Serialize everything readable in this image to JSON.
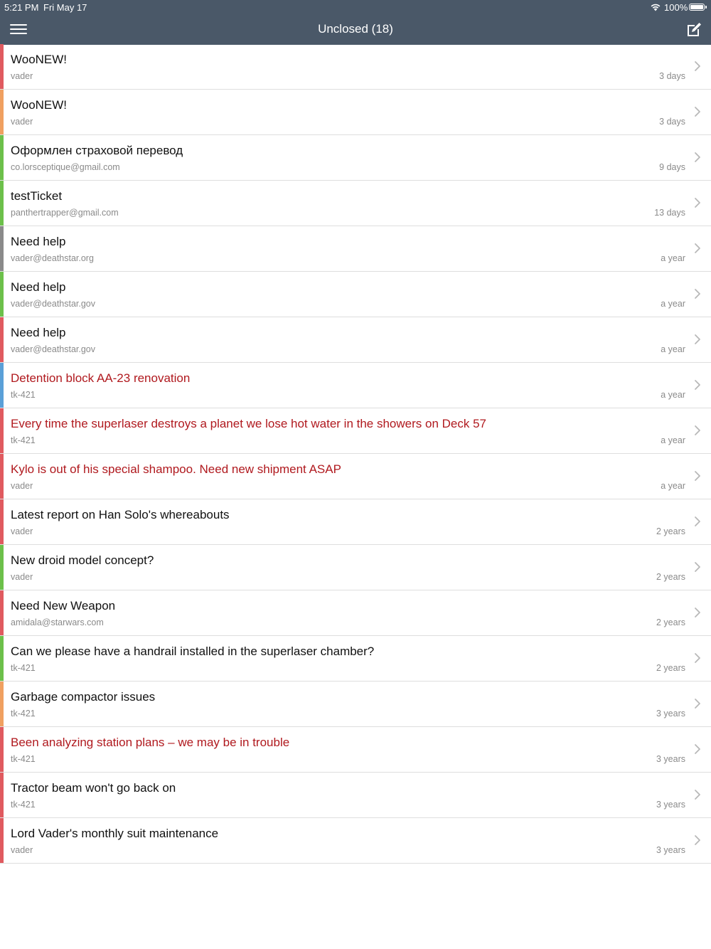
{
  "status_bar": {
    "time": "5:21 PM",
    "date": "Fri May 17",
    "battery": "100%"
  },
  "nav": {
    "title": "Unclosed (18)",
    "menu_icon": "hamburger-icon",
    "compose_icon": "compose-icon"
  },
  "colors": {
    "header": "#4a5868",
    "red": "#e05a5f",
    "orange": "#f0a060",
    "green": "#6cc04a",
    "gray": "#8a8a8a",
    "blue": "#5aa0d8",
    "urgent_text": "#b0191e"
  },
  "tickets": [
    {
      "subject": "WooNEW!",
      "sender": "vader",
      "age": "3 days",
      "bar": "#e05a5f",
      "urgent": false
    },
    {
      "subject": "WooNEW!",
      "sender": "vader",
      "age": "3 days",
      "bar": "#f0a060",
      "urgent": false
    },
    {
      "subject": "Оформлен страховой перевод",
      "sender": "co.lorsceptique@gmail.com",
      "age": "9 days",
      "bar": "#6cc04a",
      "urgent": false
    },
    {
      "subject": "testTicket",
      "sender": "panthertrapper@gmail.com",
      "age": "13 days",
      "bar": "#6cc04a",
      "urgent": false
    },
    {
      "subject": "Need help",
      "sender": "vader@deathstar.org",
      "age": "a year",
      "bar": "#8a8a8a",
      "urgent": false
    },
    {
      "subject": "Need help",
      "sender": "vader@deathstar.gov",
      "age": "a year",
      "bar": "#6cc04a",
      "urgent": false
    },
    {
      "subject": "Need help",
      "sender": "vader@deathstar.gov",
      "age": "a year",
      "bar": "#e05a5f",
      "urgent": false
    },
    {
      "subject": "Detention block AA-23 renovation",
      "sender": "tk-421",
      "age": "a year",
      "bar": "#5aa0d8",
      "urgent": true
    },
    {
      "subject": "Every time the superlaser destroys a planet we lose hot water in the showers on Deck 57",
      "sender": "tk-421",
      "age": "a year",
      "bar": "#e05a5f",
      "urgent": true
    },
    {
      "subject": "Kylo is out of his special shampoo. Need new shipment ASAP",
      "sender": "vader",
      "age": "a year",
      "bar": "#e05a5f",
      "urgent": true
    },
    {
      "subject": "Latest report on Han Solo's whereabouts",
      "sender": "vader",
      "age": "2 years",
      "bar": "#e05a5f",
      "urgent": false
    },
    {
      "subject": "New droid model concept?",
      "sender": "vader",
      "age": "2 years",
      "bar": "#6cc04a",
      "urgent": false
    },
    {
      "subject": "Need New Weapon",
      "sender": "amidala@starwars.com",
      "age": "2 years",
      "bar": "#e05a5f",
      "urgent": false
    },
    {
      "subject": "Can we please have a handrail installed in the superlaser chamber?",
      "sender": "tk-421",
      "age": "2 years",
      "bar": "#6cc04a",
      "urgent": false
    },
    {
      "subject": "Garbage compactor issues",
      "sender": "tk-421",
      "age": "3 years",
      "bar": "#f0a060",
      "urgent": false
    },
    {
      "subject": "Been analyzing station plans – we may be in trouble",
      "sender": "tk-421",
      "age": "3 years",
      "bar": "#e05a5f",
      "urgent": true
    },
    {
      "subject": "Tractor beam won't go back on",
      "sender": "tk-421",
      "age": "3 years",
      "bar": "#e05a5f",
      "urgent": false
    },
    {
      "subject": "Lord Vader's monthly suit maintenance",
      "sender": "vader",
      "age": "3 years",
      "bar": "#e05a5f",
      "urgent": false
    }
  ]
}
